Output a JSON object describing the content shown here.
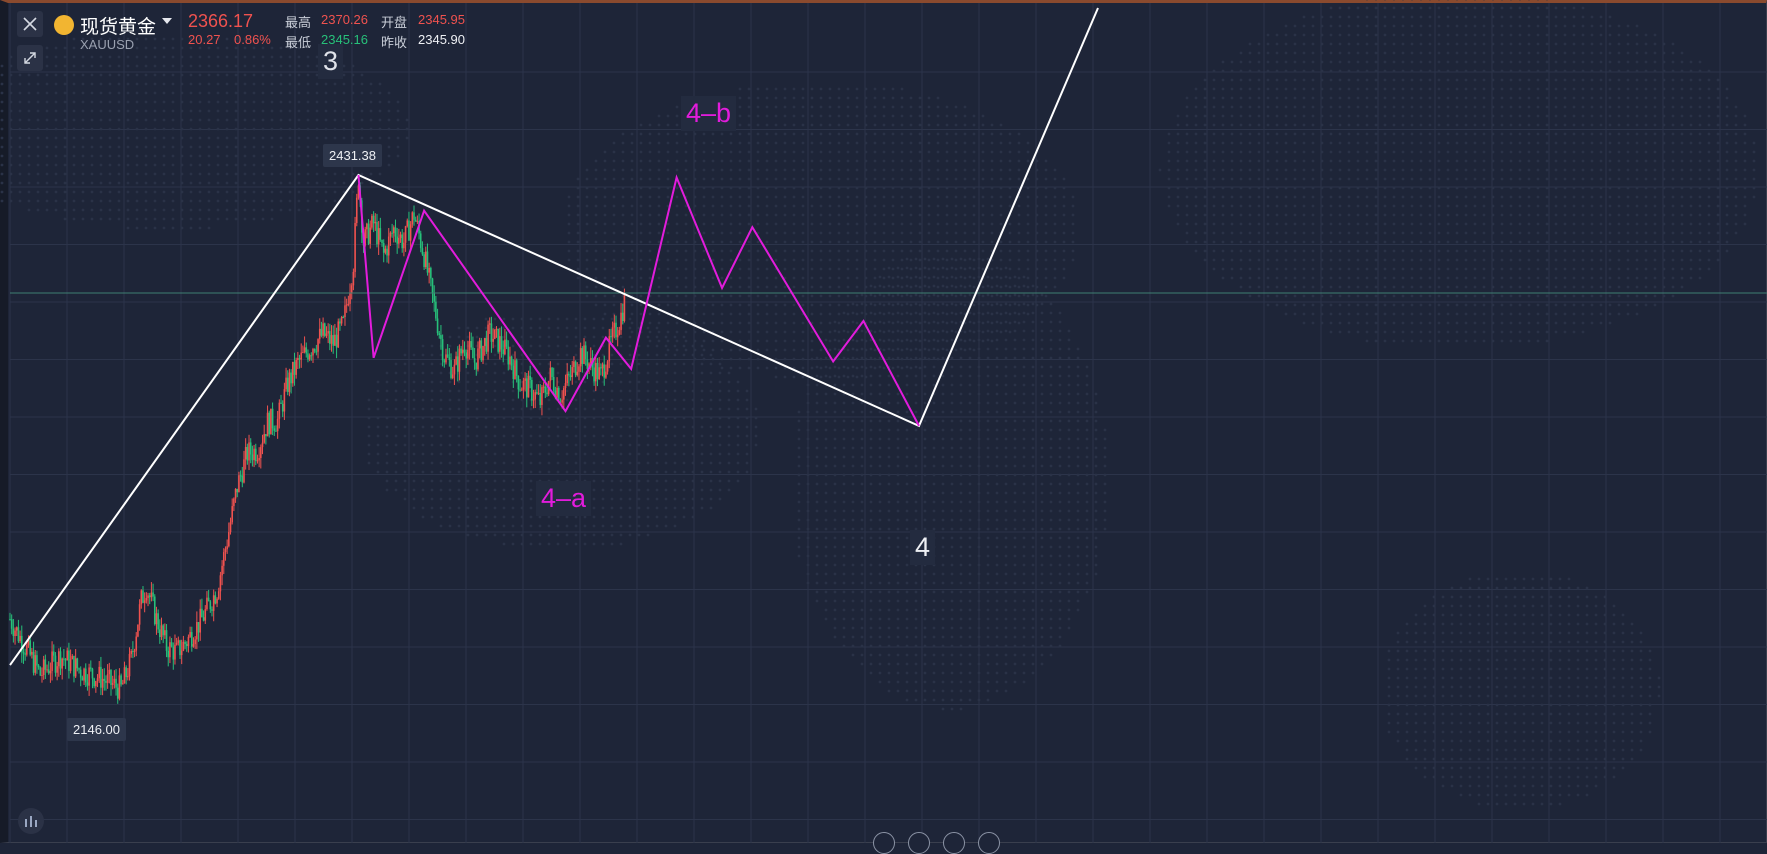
{
  "symbol": {
    "name": "现货黄金",
    "code": "XAUUSD",
    "price": "2366.17",
    "change": "20.27",
    "change_pct": "0.86%"
  },
  "stats": {
    "high_label": "最高",
    "high_value": "2370.26",
    "low_label": "最低",
    "low_value": "2345.16",
    "open_label": "开盘",
    "open_value": "2345.95",
    "prev_close_label": "昨收",
    "prev_close_value": "2345.90"
  },
  "annotations": {
    "wave_3": "3",
    "wave_4": "4",
    "wave_4a": "4–a",
    "wave_4b": "4–b",
    "peak_price": "2431.38",
    "low_price": "2146.00"
  },
  "colors": {
    "up": "#f0524f",
    "down": "#27c07a",
    "wave_projection": "#e21cdc",
    "trend_lines": "#ffffff",
    "background": "#1e2538"
  },
  "icons": {
    "close": "close-icon",
    "expand": "expand-icon",
    "indicator": "indicator-icon",
    "coin": "gold-coin-icon"
  },
  "chart_data": {
    "type": "candlestick",
    "title": "",
    "ylim": [
      2100,
      2460
    ],
    "candles_close_path": [
      [
        0,
        2190
      ],
      [
        3,
        2175
      ],
      [
        6,
        2160
      ],
      [
        10,
        2170
      ],
      [
        14,
        2162
      ],
      [
        18,
        2158
      ],
      [
        22,
        2152
      ],
      [
        24,
        2168
      ],
      [
        26,
        2200
      ],
      [
        27,
        2208
      ],
      [
        29,
        2190
      ],
      [
        31,
        2175
      ],
      [
        33,
        2172
      ],
      [
        35,
        2178
      ],
      [
        38,
        2190
      ],
      [
        41,
        2206
      ],
      [
        43,
        2233
      ],
      [
        45,
        2262
      ],
      [
        47,
        2280
      ],
      [
        49,
        2282
      ],
      [
        51,
        2297
      ],
      [
        53,
        2298
      ],
      [
        55,
        2318
      ],
      [
        57,
        2329
      ],
      [
        59,
        2336
      ],
      [
        62,
        2345
      ],
      [
        64,
        2340
      ],
      [
        66,
        2350
      ],
      [
        68,
        2384
      ],
      [
        69,
        2431
      ],
      [
        70,
        2395
      ],
      [
        72,
        2405
      ],
      [
        74,
        2388
      ],
      [
        76,
        2402
      ],
      [
        78,
        2395
      ],
      [
        80,
        2410
      ],
      [
        82,
        2388
      ],
      [
        84,
        2360
      ],
      [
        86,
        2333
      ],
      [
        88,
        2325
      ],
      [
        90,
        2340
      ],
      [
        92,
        2330
      ],
      [
        95,
        2345
      ],
      [
        97,
        2340
      ],
      [
        99,
        2332
      ],
      [
        101,
        2318
      ],
      [
        103,
        2315
      ],
      [
        105,
        2308
      ],
      [
        107,
        2322
      ],
      [
        109,
        2312
      ],
      [
        111,
        2322
      ],
      [
        113,
        2335
      ],
      [
        115,
        2328
      ],
      [
        117,
        2322
      ],
      [
        119,
        2340
      ],
      [
        121,
        2355
      ],
      [
        122,
        2366
      ]
    ],
    "elliott_wave_trend_lines": [
      [
        0,
        2165
      ],
      [
        69,
        2431.38
      ],
      [
        180,
        2295
      ],
      [
        220,
        2460
      ]
    ],
    "wave_4_projection": [
      [
        69,
        2431.38
      ],
      [
        72,
        2332
      ],
      [
        82,
        2412
      ],
      [
        110,
        2303
      ],
      [
        118,
        2343
      ],
      [
        123,
        2326
      ],
      [
        132,
        2430
      ],
      [
        141,
        2370
      ],
      [
        147,
        2403
      ],
      [
        163,
        2330
      ],
      [
        169,
        2352
      ],
      [
        180,
        2295
      ]
    ],
    "horizontal_level": 2366.17,
    "peak": 2431.38,
    "low": 2146.0
  }
}
